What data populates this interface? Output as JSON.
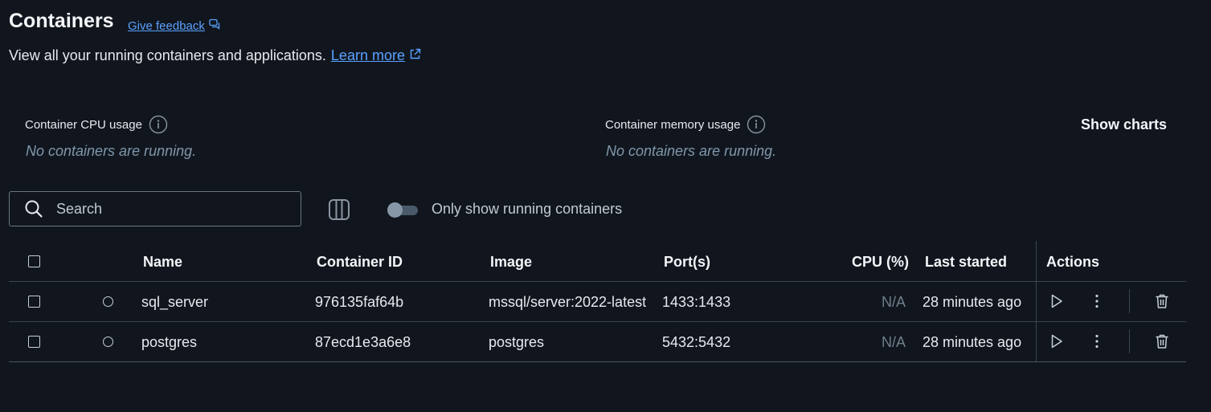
{
  "header": {
    "title": "Containers",
    "feedback_label": "Give feedback",
    "subtitle": "View all your running containers and applications.",
    "learn_more_label": "Learn more"
  },
  "stats": {
    "cpu_label": "Container CPU usage",
    "cpu_empty": "No containers are running.",
    "memory_label": "Container memory usage",
    "memory_empty": "No containers are running.",
    "show_charts_label": "Show charts"
  },
  "toolbar": {
    "search_placeholder": "Search",
    "only_running_label": "Only show running containers",
    "only_running_enabled": false
  },
  "table": {
    "columns": {
      "name": "Name",
      "container_id": "Container ID",
      "image": "Image",
      "ports": "Port(s)",
      "cpu": "CPU (%)",
      "last_started": "Last started",
      "actions": "Actions"
    },
    "rows": [
      {
        "name": "sql_server",
        "container_id": "976135faf64b",
        "image": "mssql/server:2022-latest",
        "ports": "1433:1433",
        "cpu": "N/A",
        "last_started": "28 minutes ago",
        "status": "stopped"
      },
      {
        "name": "postgres",
        "container_id": "87ecd1e3a6e8",
        "image": "postgres",
        "ports": "5432:5432",
        "cpu": "N/A",
        "last_started": "28 minutes ago",
        "status": "stopped"
      }
    ]
  },
  "icons": {
    "feedback": "feedback-chat-icon",
    "learn_more": "external-link-icon",
    "info": "info-icon",
    "search": "search-icon",
    "columns": "columns-icon",
    "start": "play-icon",
    "more": "more-vertical-icon",
    "delete": "trash-icon"
  },
  "colors": {
    "background": "#11161e",
    "link": "#5aa2ff",
    "muted_italic": "#7f97ab",
    "divider": "#3a4450"
  }
}
